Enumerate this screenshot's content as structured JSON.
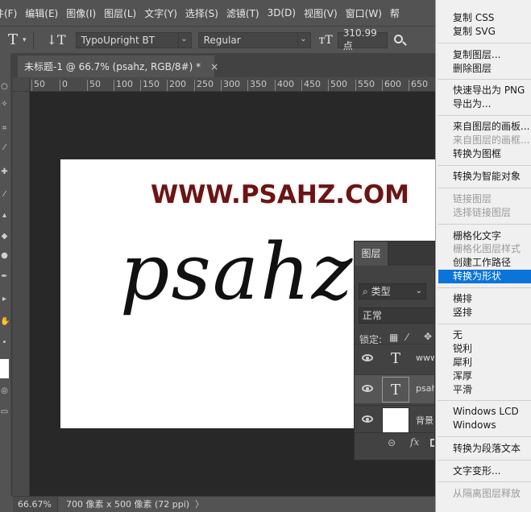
{
  "menubar": {
    "items": [
      "件(F)",
      "编辑(E)",
      "图像(I)",
      "图层(L)",
      "文字(Y)",
      "选择(S)",
      "滤镜(T)",
      "3D(D)",
      "视图(V)",
      "窗口(W)",
      "帮"
    ]
  },
  "optionsbar": {
    "tool_glyph": "T",
    "orientation_glyph": "↓T",
    "font_family": "TypoUpright BT",
    "font_style": "Regular",
    "size_glyph": "тT",
    "font_size": "310.99 点"
  },
  "document": {
    "tab_title": "未标题-1 @ 66.7% (psahz, RGB/8#) *",
    "close_glyph": "×",
    "watermark_text": "WWW.PSAHZ.COM",
    "script_text": "psahz"
  },
  "ruler": {
    "ticks": [
      "50",
      "0",
      "50",
      "100",
      "150",
      "200",
      "250",
      "300",
      "350",
      "400",
      "450",
      "500",
      "550",
      "600",
      "650"
    ]
  },
  "layers_panel": {
    "tab_label": "图层",
    "filter_label": "类型",
    "blend_mode": "正常",
    "lock_label": "锁定:",
    "layers": [
      {
        "thumb": "T",
        "name": "www"
      },
      {
        "thumb": "T",
        "name": "psah"
      },
      {
        "thumb": "",
        "name": "背景"
      }
    ],
    "footer_link": "⊝",
    "footer_fx": "fx"
  },
  "statusbar": {
    "zoom": "66.67%",
    "dimensions": "700 像素 x 500 像素 (72 ppi)",
    "more": "〉"
  },
  "context_menu": {
    "items": [
      {
        "label": "复制 CSS",
        "state": "normal"
      },
      {
        "label": "复制 SVG",
        "state": "normal"
      },
      {
        "label": "复制图层...",
        "state": "normal"
      },
      {
        "label": "删除图层",
        "state": "normal"
      },
      {
        "label": "快速导出为 PNG",
        "state": "normal"
      },
      {
        "label": "导出为...",
        "state": "normal"
      },
      {
        "label": "来自图层的画板...",
        "state": "normal"
      },
      {
        "label": "来自图层的画框...",
        "state": "disabled"
      },
      {
        "label": "转换为图框",
        "state": "normal"
      },
      {
        "label": "转换为智能对象",
        "state": "normal"
      },
      {
        "label": "链接图层",
        "state": "disabled"
      },
      {
        "label": "选择链接图层",
        "state": "disabled"
      },
      {
        "label": "栅格化文字",
        "state": "normal"
      },
      {
        "label": "栅格化图层样式",
        "state": "disabled"
      },
      {
        "label": "创建工作路径",
        "state": "normal"
      },
      {
        "label": "转换为形状",
        "state": "highlighted"
      },
      {
        "label": "横排",
        "state": "normal"
      },
      {
        "label": "竖排",
        "state": "normal"
      },
      {
        "label": "无",
        "state": "normal"
      },
      {
        "label": "锐利",
        "state": "normal"
      },
      {
        "label": "犀利",
        "state": "normal"
      },
      {
        "label": "浑厚",
        "state": "normal"
      },
      {
        "label": "平滑",
        "state": "normal"
      },
      {
        "label": "Windows LCD",
        "state": "normal"
      },
      {
        "label": "Windows",
        "state": "normal"
      },
      {
        "label": "转换为段落文本",
        "state": "normal"
      },
      {
        "label": "文字变形...",
        "state": "normal"
      },
      {
        "label": "从隔离图层释放",
        "state": "disabled"
      }
    ]
  },
  "colors": {
    "highlight": "#0a74d9",
    "watermark": "#6a1515",
    "panel": "#535353",
    "canvas_bg": "#282828"
  }
}
